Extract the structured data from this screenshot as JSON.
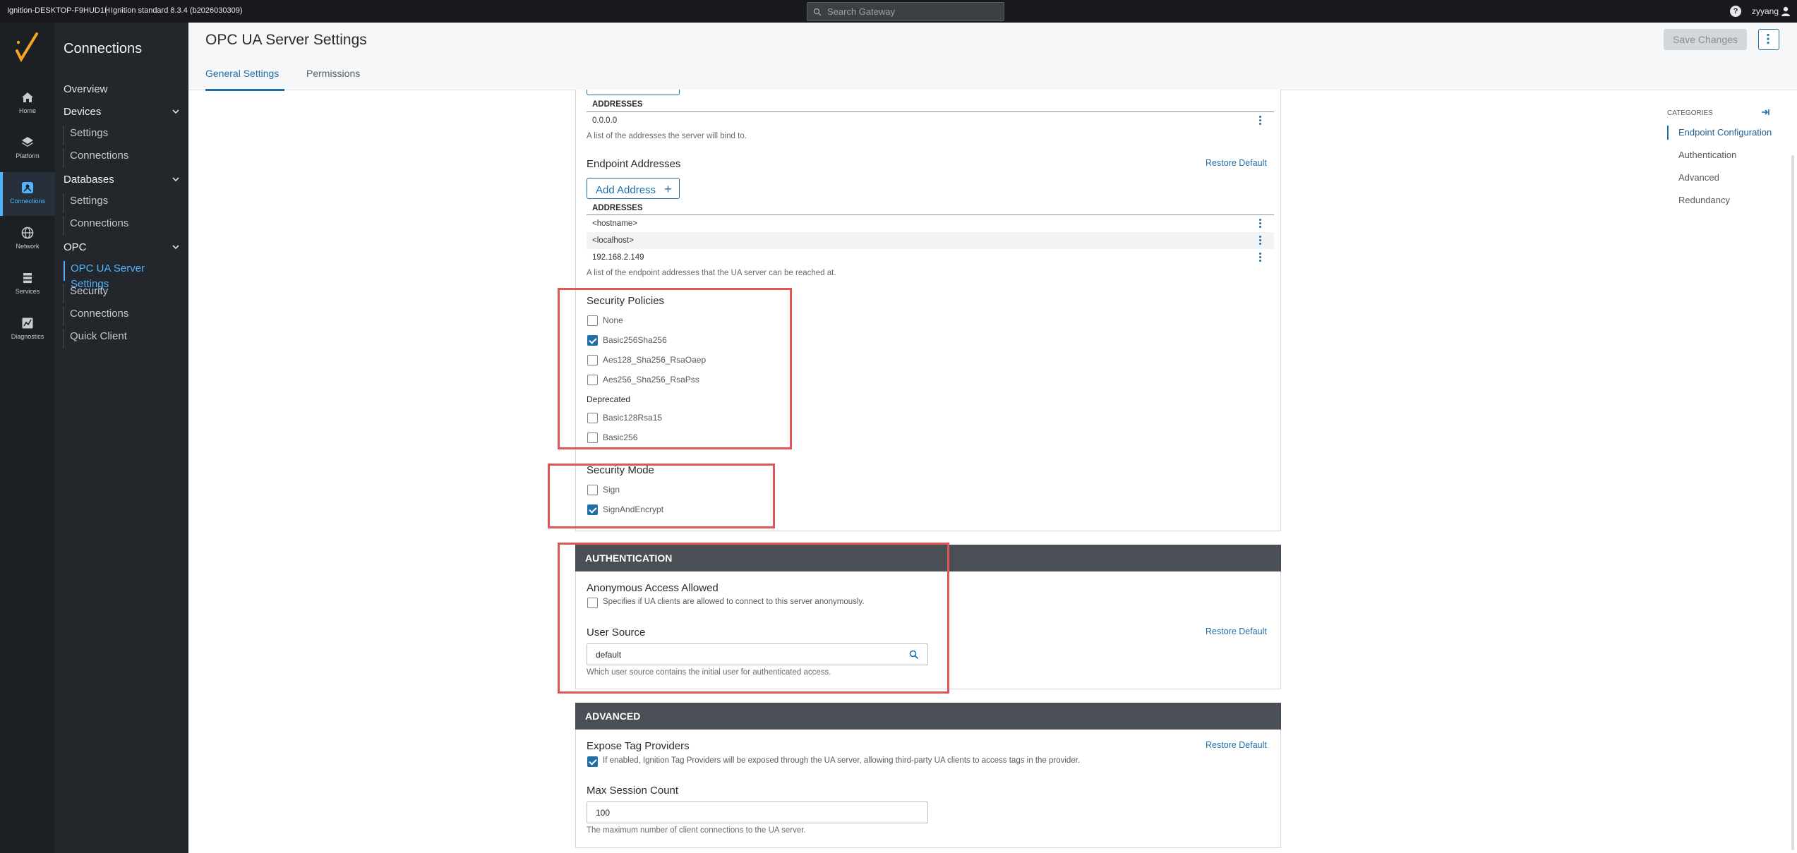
{
  "topbar": {
    "gateway_name": "Ignition-DESKTOP-F9HUD1H",
    "gateway_version": "Ignition standard 8.3.4 (b2026030309)",
    "search_placeholder": "Search Gateway",
    "username": "zyyang",
    "help_icon": "help-icon",
    "user_icon": "user-icon"
  },
  "rail": [
    {
      "label": "Home",
      "icon": "home-icon"
    },
    {
      "label": "Platform",
      "icon": "layers-icon"
    },
    {
      "label": "Connections",
      "icon": "connections-icon"
    },
    {
      "label": "Network",
      "icon": "globe-icon"
    },
    {
      "label": "Services",
      "icon": "stack-icon"
    },
    {
      "label": "Diagnostics",
      "icon": "chart-icon"
    }
  ],
  "subnav": {
    "title": "Connections",
    "overview": "Overview",
    "devices": "Devices",
    "devices_settings": "Settings",
    "devices_connections": "Connections",
    "databases": "Databases",
    "databases_settings": "Settings",
    "databases_connections": "Connections",
    "opc": "OPC",
    "opc_ua_server_settings": "OPC UA Server Settings",
    "opc_security": "Security",
    "opc_connections": "Connections",
    "opc_quick_client": "Quick Client"
  },
  "header": {
    "page_title": "OPC UA Server Settings",
    "tabs": [
      "General Settings",
      "Permissions"
    ],
    "save_label": "Save Changes"
  },
  "endpoint": {
    "bind_column": "ADDRESSES",
    "bind_addresses": [
      "0.0.0.0"
    ],
    "bind_desc": "A list of the addresses the server will bind to.",
    "endpoint_label": "Endpoint Addresses",
    "restore_label": "Restore Default",
    "add_address_label": "Add Address",
    "endpoint_column": "ADDRESSES",
    "endpoint_addresses": [
      "<hostname>",
      "<localhost>",
      "192.168.2.149"
    ],
    "endpoint_desc": "A list of the endpoint addresses that the UA server can be reached at.",
    "security_policies_label": "Security Policies",
    "policies": [
      {
        "label": "None",
        "checked": false
      },
      {
        "label": "Basic256Sha256",
        "checked": true
      },
      {
        "label": "Aes128_Sha256_RsaOaep",
        "checked": false
      },
      {
        "label": "Aes256_Sha256_RsaPss",
        "checked": false
      }
    ],
    "deprecated_label": "Deprecated",
    "deprecated_policies": [
      {
        "label": "Basic128Rsa15",
        "checked": false
      },
      {
        "label": "Basic256",
        "checked": false
      }
    ],
    "security_mode_label": "Security Mode",
    "modes": [
      {
        "label": "Sign",
        "checked": false
      },
      {
        "label": "SignAndEncrypt",
        "checked": true
      }
    ]
  },
  "authentication": {
    "header": "AUTHENTICATION",
    "anon_label": "Anonymous Access Allowed",
    "anon_desc": "Specifies if UA clients are allowed to connect to this server anonymously.",
    "anon_checked": false,
    "user_source_label": "User Source",
    "restore_label": "Restore Default",
    "user_source_value": "default",
    "user_source_desc": "Which user source contains the initial user for authenticated access."
  },
  "advanced": {
    "header": "ADVANCED",
    "expose_label": "Expose Tag Providers",
    "restore_label": "Restore Default",
    "expose_desc": "If enabled, Ignition Tag Providers will be exposed through the UA server, allowing third-party UA clients to access tags in the provider.",
    "expose_checked": true,
    "max_session_label": "Max Session Count",
    "max_session_value": "100",
    "max_session_desc": "The maximum number of client connections to the UA server."
  },
  "categories": {
    "title": "CATEGORIES",
    "items": [
      "Endpoint Configuration",
      "Authentication",
      "Advanced",
      "Redundancy"
    ]
  },
  "colors": {
    "accent": "#1f6fa8",
    "highlight_box": "#e05555",
    "section_header": "#4a4f55"
  }
}
